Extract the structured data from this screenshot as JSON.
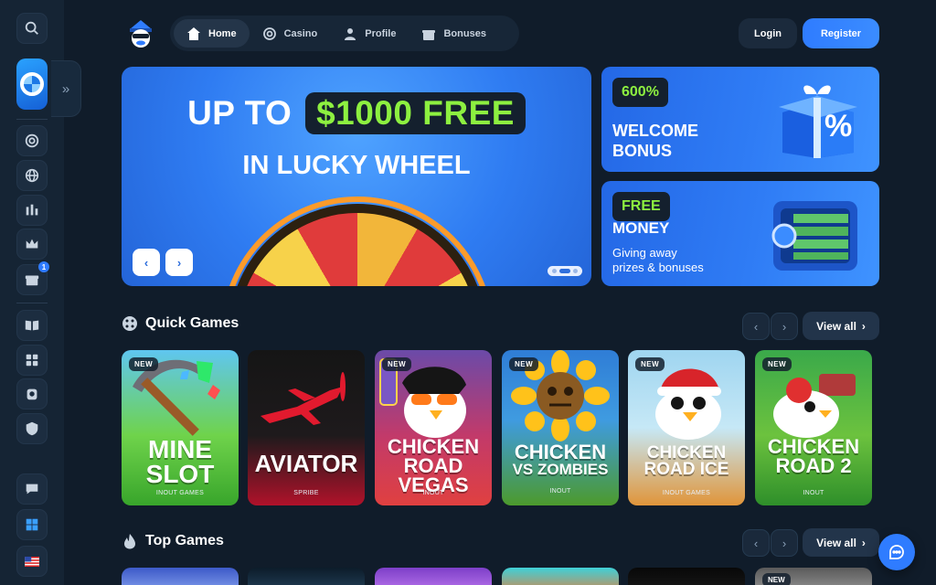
{
  "nav": {
    "items": [
      {
        "label": "Home",
        "icon": "home-icon",
        "active": true
      },
      {
        "label": "Casino",
        "icon": "chip-icon",
        "active": false
      },
      {
        "label": "Profile",
        "icon": "user-icon",
        "active": false
      },
      {
        "label": "Bonuses",
        "icon": "gift-icon",
        "active": false
      }
    ]
  },
  "auth": {
    "login": "Login",
    "register": "Register"
  },
  "sidebar": {
    "bonus_badge": "1",
    "icons": [
      "search-icon",
      "lucky-wheel-icon",
      "chip-icon",
      "globe-icon",
      "bars-icon",
      "crown-icon",
      "gift-icon",
      "book-icon",
      "puzzle-icon",
      "badge-icon",
      "shield-icon",
      "telegram-icon",
      "chat-icon",
      "windows-icon",
      "us-flag-icon"
    ]
  },
  "hero": {
    "line1_prefix": "UP TO",
    "line1_highlight": "$1000 FREE",
    "line2": "IN LUCKY WHEEL",
    "prev": "‹",
    "next": "›",
    "slides": 3,
    "active_slide": 2
  },
  "promos": [
    {
      "tag": "600%",
      "title_1": "WELCOME",
      "title_2": "BONUS"
    },
    {
      "tag": "FREE",
      "title_1": "MONEY",
      "sub_1": "Giving away",
      "sub_2": "prizes & bonuses"
    }
  ],
  "quick_games": {
    "title": "Quick Games",
    "view_all": "View all",
    "prev": "‹",
    "next": "›",
    "games": [
      {
        "title_1": "MINE",
        "title_2": "SLOT",
        "provider": "INOUT GAMES",
        "new": "NEW"
      },
      {
        "title_1": "AVIATOR",
        "title_2": "",
        "provider": "SPRIBE",
        "new": ""
      },
      {
        "title_1": "CHICKEN",
        "title_2": "ROAD VEGAS",
        "provider": "INOUT",
        "new": "NEW"
      },
      {
        "title_1": "CHICKEN",
        "title_2": "VS ZOMBIES",
        "provider": "INOUT",
        "new": "NEW"
      },
      {
        "title_1": "CHICKEN",
        "title_2": "ROAD ICE",
        "provider": "INOUT GAMES",
        "new": "NEW"
      },
      {
        "title_1": "CHICKEN",
        "title_2": "ROAD 2",
        "provider": "INOUT",
        "new": "NEW"
      }
    ]
  },
  "top_games": {
    "title": "Top Games",
    "view_all": "View all",
    "prev": "‹",
    "next": "›",
    "last_new": "NEW"
  },
  "colors": {
    "accent": "#2f7cff",
    "highlight": "#8df040",
    "bg": "#101c2a"
  }
}
